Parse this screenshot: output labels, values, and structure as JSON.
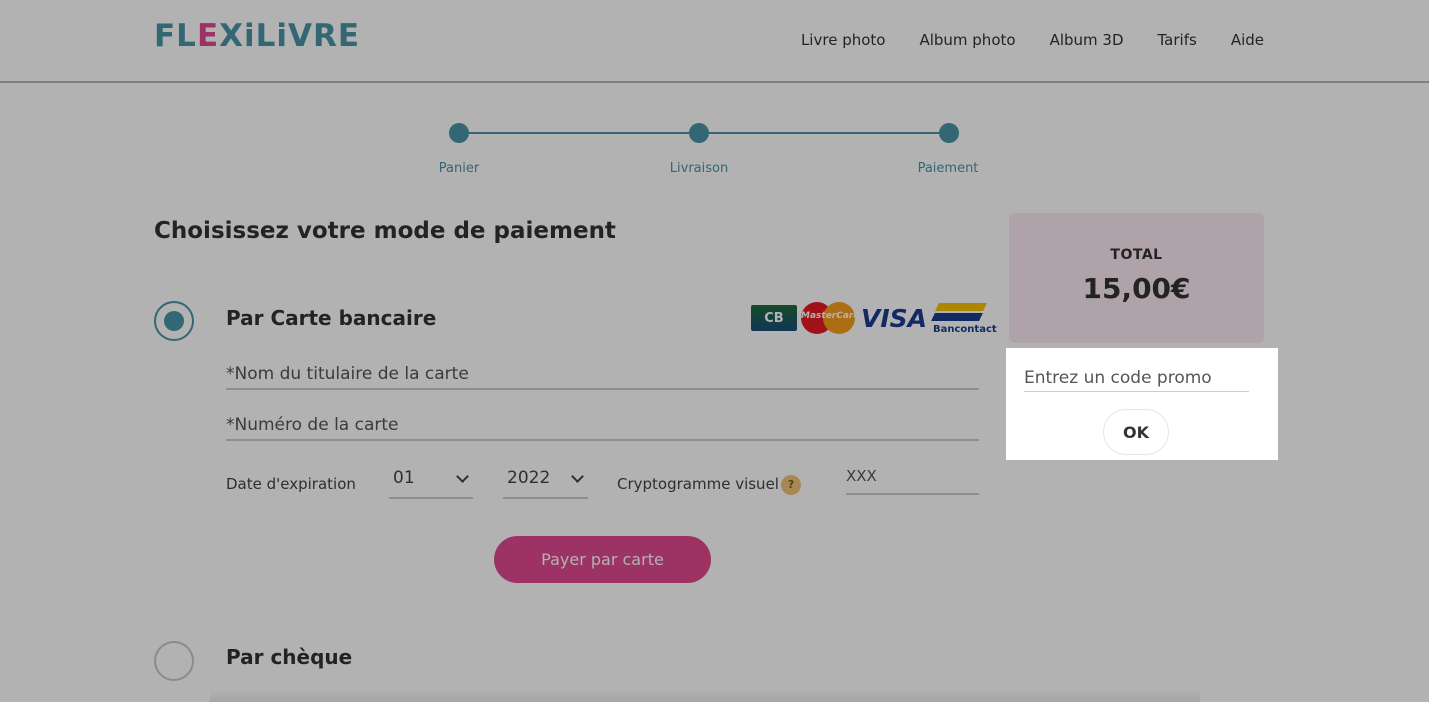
{
  "header": {
    "logo_part1": "FL",
    "logo_part2": "E",
    "logo_part3": "XiLiVRE",
    "nav": [
      "Livre photo",
      "Album photo",
      "Album 3D",
      "Tarifs",
      "Aide"
    ]
  },
  "steps": [
    {
      "label": "Panier",
      "done": true
    },
    {
      "label": "Livraison",
      "done": true
    },
    {
      "label": "Paiement",
      "done": true
    }
  ],
  "page_title": "Choisissez votre mode de paiement",
  "payment_methods": [
    {
      "label": "Par Carte bancaire",
      "selected": true
    },
    {
      "label": "Par chèque",
      "selected": false
    }
  ],
  "card_logos": {
    "cb": "CB",
    "mastercard": "MasterCard",
    "visa": "VISA",
    "bancontact": "Bancontact"
  },
  "card_form": {
    "holder_placeholder": "*Nom du titulaire de la carte",
    "number_placeholder": "*Numéro de la carte",
    "expiry_label": "Date d'expiration",
    "expiry_month": "01",
    "expiry_year": "2022",
    "cvv_label": "Cryptogramme visuel",
    "cvv_help": "?",
    "cvv_placeholder": "XXX",
    "pay_button": "Payer par carte"
  },
  "summary": {
    "total_label": "TOTAL",
    "total_value": "15,00€"
  },
  "promo": {
    "placeholder": "Entrez un code promo",
    "ok_button": "OK"
  },
  "colors": {
    "teal": "#4a94a6",
    "pink": "#e04a90",
    "total_bg": "#fbe9f1"
  }
}
